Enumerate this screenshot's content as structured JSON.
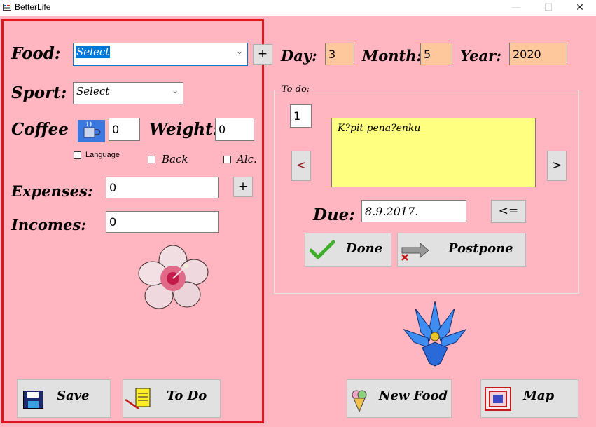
{
  "window": {
    "title": "BetterLife",
    "minimize": "—",
    "maximize": "☐",
    "close": "✕"
  },
  "left": {
    "food": {
      "label": "Food:",
      "value": "Select",
      "add": "+"
    },
    "sport": {
      "label": "Sport:",
      "value": "Select"
    },
    "coffee": {
      "label": "Coffee",
      "value": "0",
      "icon": "coffee-cup-icon"
    },
    "weight": {
      "label": "Weight:",
      "value": "0"
    },
    "checks": {
      "language": "Language",
      "back": "Back",
      "alc": "Alc."
    },
    "expenses": {
      "label": "Expenses:",
      "value": "0",
      "add": "+"
    },
    "incomes": {
      "label": "Incomes:",
      "value": "0"
    },
    "save": "Save",
    "todo": "To Do"
  },
  "date": {
    "day_label": "Day:",
    "day": "3",
    "month_label": "Month:",
    "month": "5",
    "year_label": "Year:",
    "year": "2020"
  },
  "todo_panel": {
    "legend": "To do:",
    "index": "1",
    "note": "K?pit pena?enku",
    "prev": "<",
    "next": ">",
    "due_label": "Due:",
    "due_value": "8.9.2017.",
    "back_arrow": "<=",
    "done": "Done",
    "postpone": "Postpone"
  },
  "bottom": {
    "new_food": "New Food",
    "map": "Map"
  },
  "colors": {
    "background": "#ffb6c1",
    "frame": "#e0141e",
    "note": "#ffff80",
    "date_fields": "#ffc89c"
  }
}
